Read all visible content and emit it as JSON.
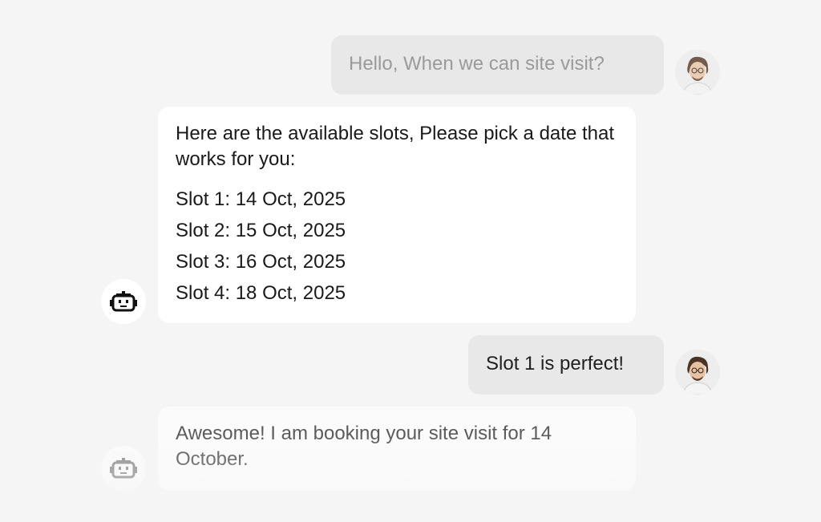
{
  "messages": {
    "user_1": "Hello, When we can site visit?",
    "bot_1": {
      "intro": "Here are the available slots, Please pick a date that works for you:",
      "slots": [
        "Slot 1: 14 Oct, 2025",
        "Slot 2: 15 Oct, 2025",
        "Slot 3: 16 Oct, 2025",
        "Slot 4: 18 Oct, 2025"
      ]
    },
    "user_2": "Slot 1 is perfect!",
    "bot_2": "Awesome! I am booking your site visit for 14 October."
  },
  "icons": {
    "bot_avatar": "robot-icon",
    "user_avatar": "user-photo-avatar"
  },
  "colors": {
    "background": "#f5f5f5",
    "user_bubble": "#e8e8e8",
    "bot_bubble": "#ffffff"
  }
}
